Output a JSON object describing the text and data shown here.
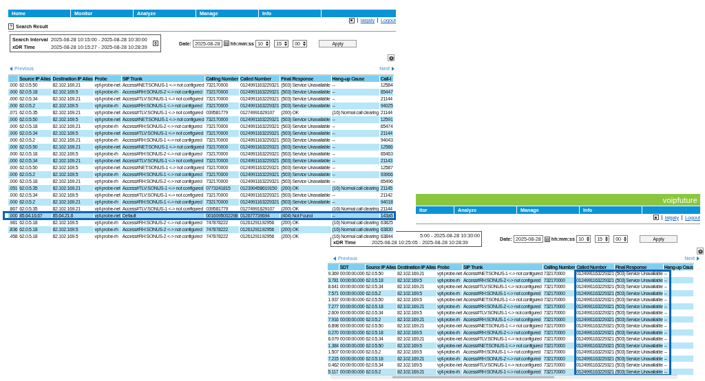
{
  "front_window": {
    "menu": [
      "Home",
      "Monitor",
      "Analyze",
      "Manage",
      "Info"
    ],
    "user_links": [
      "lalgaly",
      "Logout"
    ],
    "help_icon": "?",
    "title": "Search Result",
    "search_summary": [
      {
        "label": "Search Interval",
        "value": "2025-08-28 10:15:00 - 2025-08-28 10:30:00"
      },
      {
        "label": "xDR Time",
        "value": "2025-08-28 10:15:27 - 2025-08-28 10:28:39"
      }
    ],
    "date_label": "Date:",
    "date": "2025-08-28",
    "time_label": "hh:mm:ss",
    "time": [
      "10",
      "15",
      "00"
    ],
    "apply": "Apply",
    "previous": "Previous",
    "next": "Next",
    "table": {
      "columns": [
        "",
        "Source IP Alias",
        "Destination IP Alias",
        "Probe",
        "SIP Trunk",
        "Calling Number",
        "Called Number",
        "Final Response",
        "Hang-up Cause",
        "Call-I"
      ],
      "rows": [
        {
          "cells": [
            ".000",
            "62.0.5.50",
            "82.102.169.21",
            "vpf-probe-net",
            "Access#NET:SONUS-1 <-> not configured",
            "732170000",
            "0124991163229321",
            "(503) Service Unavailable",
            "--",
            "12584"
          ],
          "selected": false
        },
        {
          "cells": [
            ".000",
            "62.0.5.18",
            "82.102.169.5",
            "vpf-probe-rh",
            "Access#RH:SONUS-2 <-> not configured",
            "732170000",
            "0124991163229321",
            "(503) Service Unavailable",
            "--",
            "65447"
          ],
          "selected": false
        },
        {
          "cells": [
            ".000",
            "62.0.5.34",
            "82.102.169.21",
            "vpf-probe-net",
            "Access#TLV:SONUS-1 <-> not configured",
            "732170000",
            "0124991163229321",
            "(503) Service Unavailable",
            "--",
            "21144"
          ],
          "selected": false
        },
        {
          "cells": [
            ".000",
            "62.0.5.2",
            "82.102.169.5",
            "vpf-probe-rh",
            "Access#RH:SONUS-1 <-> not configured",
            "732170000",
            "0124991163229321",
            "(503) Service Unavailable",
            "--",
            "94025"
          ],
          "selected": false
        },
        {
          "cells": [
            ".071",
            "62.0.5.35",
            "82.102.169.21",
            "vpf-probe-net",
            "Access#TLV:SONUS-1 <-> not configured",
            "039581779",
            "01274991629107",
            "(200) OK",
            "(16) Normal call clearing",
            "21144"
          ],
          "selected": false
        },
        {
          "cells": [
            ".000",
            "62.0.5.50",
            "82.102.169.5",
            "vpf-probe-net",
            "Access#NET:SONUS-1 <-> not configured",
            "732170000",
            "0124991163229321",
            "(503) Service Unavailable",
            "--",
            "12591"
          ],
          "selected": false
        },
        {
          "cells": [
            ".000",
            "62.0.5.18",
            "82.102.169.21",
            "vpf-probe-rh",
            "Access#RH:SONUS-2 <-> not configured",
            "732170000",
            "0124991163229321",
            "(503) Service Unavailable",
            "--",
            "65474"
          ],
          "selected": false
        },
        {
          "cells": [
            ".000",
            "62.0.5.34",
            "82.102.169.5",
            "vpf-probe-net",
            "Access#TLV:SONUS-1 <-> not configured",
            "732170000",
            "0124991163229321",
            "(503) Service Unavailable",
            "--",
            "21144"
          ],
          "selected": false
        },
        {
          "cells": [
            ".000",
            "62.0.5.2",
            "82.102.169.21",
            "vpf-probe-rh",
            "Access#RH:SONUS-1 <-> not configured",
            "732170000",
            "0124991163229321",
            "(503) Service Unavailable",
            "--",
            "94043"
          ],
          "selected": false
        },
        {
          "cells": [
            ".000",
            "62.0.5.50",
            "82.102.169.21",
            "vpf-probe-net",
            "Access#NET:SONUS-1 <-> not configured",
            "732170000",
            "0124991163229321",
            "(503) Service Unavailable",
            "--",
            "12586"
          ],
          "selected": false
        },
        {
          "cells": [
            ".000",
            "62.0.5.18",
            "82.102.169.5",
            "vpf-probe-rh",
            "Access#RH:SONUS-2 <-> not configured",
            "732170000",
            "0124991163229321",
            "(503) Service Unavailable",
            "--",
            "65463"
          ],
          "selected": false
        },
        {
          "cells": [
            ".000",
            "62.0.5.34",
            "82.102.169.21",
            "vpf-probe-net",
            "Access#TLV:SONUS-1 <-> not configured",
            "732170000",
            "0124991163229321",
            "(503) Service Unavailable",
            "--",
            "21143"
          ],
          "selected": false
        },
        {
          "cells": [
            ".000",
            "62.0.5.50",
            "82.102.169.5",
            "vpf-probe-net",
            "Access#NET:SONUS-1 <-> not configured",
            "732170000",
            "0124991163229321",
            "(503) Service Unavailable",
            "--",
            "12587"
          ],
          "selected": false
        },
        {
          "cells": [
            ".000",
            "62.0.5.2",
            "82.102.169.5",
            "vpf-probe-rh",
            "Access#RH:SONUS-1 <-> not configured",
            "732170000",
            "0124991163229321",
            "(503) Service Unavailable",
            "--",
            "93966"
          ],
          "selected": false
        },
        {
          "cells": [
            ".000",
            "62.0.5.18",
            "82.102.169.21",
            "vpf-probe-rh",
            "Access#RH:SONUS-2 <-> not configured",
            "732170000",
            "0124991163229321",
            "(503) Service Unavailable",
            "--",
            "65496"
          ],
          "selected": false
        },
        {
          "cells": [
            ".051",
            "62.0.5.35",
            "82.102.169.21",
            "vpf-probe-net",
            "Access#TLV:SONUS-1 <-> not configured",
            "0773241815",
            "012390458619150",
            "(200) OK",
            "(16) Normal call clearing",
            "21145"
          ],
          "selected": false
        },
        {
          "cells": [
            ".000",
            "62.0.5.34",
            "82.102.169.5",
            "vpf-probe-net",
            "Access#TLV:SONUS-1 <-> not configured",
            "732170000",
            "0124991163229321",
            "(503) Service Unavailable",
            "--",
            "21142"
          ],
          "selected": false
        },
        {
          "cells": [
            ".000",
            "62.0.5.2",
            "82.102.169.21",
            "vpf-probe-rh",
            "Access#RH:SONUS-1 <-> not configured",
            "732170000",
            "0124991163229321",
            "(503) Service Unavailable",
            "--",
            "94018"
          ],
          "selected": false
        },
        {
          "cells": [
            ".867",
            "62.0.5.35",
            "82.102.169.21",
            "vpf-probe-net",
            "Access#TLV:SONUS-1 <-> not configured",
            "039581779",
            "01274991629107",
            "(200) OK",
            "(16) Normal call clearing",
            "21144"
          ],
          "selected": false
        },
        {
          "cells": [
            ".000",
            "85.64.16.67",
            "85.64.21.8",
            "vpf-probe-net",
            "Default",
            "0016095002298",
            "012677739694",
            "(404) Not Found",
            "--",
            "143a5"
          ],
          "selected": true
        },
        {
          "cells": [
            ".981",
            "62.0.5.18",
            "82.102.169.5",
            "vpf-probe-rh",
            "Access#RH:SONUS-2 <-> not configured",
            "747878222",
            "01261291192956",
            "(200) OK",
            "(16) Normal call clearing",
            "63825"
          ],
          "selected": false
        },
        {
          "cells": [
            ".836",
            "62.0.5.18",
            "82.102.169.5",
            "vpf-probe-rh",
            "Access#RH:SONUS-2 <-> not configured",
            "747878222",
            "01261291192956",
            "(200) OK",
            "(16) Normal call clearing",
            "63830"
          ],
          "selected": false
        },
        {
          "cells": [
            ".458",
            "62.0.5.18",
            "82.102.169.5",
            "vpf-probe-rh",
            "Access#RH:SONUS-2 <-> not configured",
            "747878222",
            "01261291192956",
            "(200) OK",
            "(16) Normal call clearing",
            "63844"
          ],
          "selected": false
        }
      ]
    }
  },
  "back_window": {
    "logo": "voipfuture",
    "menu": [
      "itor",
      "Analyze",
      "Manage",
      "Info"
    ],
    "user_links": [
      "lalgaly",
      "Logout"
    ],
    "search_summary": [
      {
        "value": "5:00 - 2025-08-28 10:30:00"
      },
      {
        "label": "xDR Time",
        "value": "2025-08-28 10:25:05 - 2025-08-28 10:28:39"
      }
    ],
    "date_label": "Date:",
    "date": "2025-08-28",
    "time_label": "hh:mm:ss",
    "time": [
      "10",
      "15",
      "00"
    ],
    "apply": "Apply",
    "previous": "Previous",
    "next": "Next",
    "table": {
      "columns": [
        {
          "framed": false
        },
        {
          "label": "SDT",
          "framed": false
        },
        {
          "label": "Source IP Alias",
          "framed": false
        },
        {
          "label": "Destination IP Alias",
          "framed": false
        },
        {
          "label": "Probe",
          "framed": false
        },
        {
          "label": "SIP Trunk",
          "framed": false
        },
        {
          "label": "Calling Number",
          "framed": false
        },
        {
          "label": "Called Number",
          "framed": true
        },
        {
          "label": "Final Response",
          "framed": true
        },
        {
          "label": "Hang-up Caus",
          "framed": false
        }
      ],
      "rows": [
        {
          "cells": [
            "9.369",
            "00:00:00.000",
            "62.0.5.50",
            "82.102.169.21",
            "vpf-probe-net",
            "Access#NET:SONUS-1 <-> not configured",
            "732170000",
            "0124991163229321",
            "(503) Service Unavailable",
            "--"
          ]
        },
        {
          "cells": [
            "3.781",
            "00:00:00.000",
            "62.0.5.18",
            "82.102.169.5",
            "vpf-probe-rh",
            "Access#RH:SONUS-2 <-> not configured",
            "732170000",
            "0124991163229321",
            "(503) Service Unavailable",
            "--"
          ]
        },
        {
          "cells": [
            "8.641",
            "00:00:00.000",
            "62.0.5.34",
            "82.102.169.21",
            "vpf-probe-net",
            "Access#TLV:SONUS-1 <-> not configured",
            "732170000",
            "0124991163229321",
            "(503) Service Unavailable",
            "--"
          ]
        },
        {
          "cells": [
            "7.571",
            "00:00:00.000",
            "62.0.5.2",
            "82.102.169.5",
            "vpf-probe-rh",
            "Access#RH:SONUS-1 <-> not configured",
            "732170000",
            "0124991163229321",
            "(503) Service Unavailable",
            "--"
          ]
        },
        {
          "cells": [
            "1.937",
            "00:00:00.000",
            "62.0.5.50",
            "82.102.169.5",
            "vpf-probe-net",
            "Access#NET:SONUS-1 <-> not configured",
            "732170000",
            "0124991163229321",
            "(503) Service Unavailable",
            "--"
          ]
        },
        {
          "cells": [
            "7.277",
            "00:00:00.000",
            "62.0.5.18",
            "82.102.169.21",
            "vpf-probe-rh",
            "Access#RH:SONUS-2 <-> not configured",
            "732170000",
            "0124991163229321",
            "(503) Service Unavailable",
            "--"
          ]
        },
        {
          "cells": [
            "2.609",
            "00:00:00.000",
            "62.0.5.34",
            "82.102.169.5",
            "vpf-probe-net",
            "Access#TLV:SONUS-1 <-> not configured",
            "732170000",
            "0124991163229321",
            "(503) Service Unavailable",
            "--"
          ]
        },
        {
          "cells": [
            "7.916",
            "00:00:00.000",
            "62.0.5.2",
            "82.102.169.21",
            "vpf-probe-rh",
            "Access#RH:SONUS-1 <-> not configured",
            "732170000",
            "0124991163229321",
            "(503) Service Unavailable",
            "--"
          ]
        },
        {
          "cells": [
            "6.898",
            "00:00:00.000",
            "62.0.5.50",
            "82.102.169.21",
            "vpf-probe-net",
            "Access#NET:SONUS-1 <-> not configured",
            "732170000",
            "0124991163229321",
            "(503) Service Unavailable",
            "--"
          ]
        },
        {
          "cells": [
            "0.270",
            "00:00:00.000",
            "62.0.5.18",
            "82.102.169.5",
            "vpf-probe-rh",
            "Access#RH:SONUS-2 <-> not configured",
            "732170000",
            "0124991163229321",
            "(503) Service Unavailable",
            "--"
          ]
        },
        {
          "cells": [
            "6.079",
            "00:00:00.000",
            "62.0.5.34",
            "82.102.169.21",
            "vpf-probe-net",
            "Access#TLV:SONUS-1 <-> not configured",
            "732170000",
            "0124991163229321",
            "(503) Service Unavailable",
            "--"
          ]
        },
        {
          "cells": [
            "1.384",
            "00:00:00.000",
            "62.0.5.50",
            "82.102.169.5",
            "vpf-probe-net",
            "Access#NET:SONUS-1 <-> not configured",
            "732170000",
            "0124991163229321",
            "(503) Service Unavailable",
            "--"
          ]
        },
        {
          "cells": [
            "1.507",
            "00:00:00.000",
            "62.0.5.2",
            "82.102.169.5",
            "vpf-probe-rh",
            "Access#RH:SONUS-1 <-> not configured",
            "732170000",
            "0124991163229321",
            "(503) Service Unavailable",
            "--"
          ]
        },
        {
          "cells": [
            "7.215",
            "00:00:00.000",
            "62.0.5.18",
            "82.102.169.21",
            "vpf-probe-rh",
            "Access#RH:SONUS-2 <-> not configured",
            "732170000",
            "0124991163229321",
            "(503) Service Unavailable",
            "--"
          ]
        },
        {
          "cells": [
            "0.462",
            "00:00:00.000",
            "62.0.5.34",
            "82.102.169.5",
            "vpf-probe-net",
            "Access#TLV:SONUS-1 <-> not configured",
            "732170000",
            "0124991163229321",
            "(503) Service Unavailable",
            "--"
          ]
        },
        {
          "cells": [
            "5.117",
            "00:00:00.000",
            "62.0.5.2",
            "82.102.169.21",
            "vpf-probe-rh",
            "Access#RH:SONUS-1 <-> not configured",
            "732170000",
            "0124991163229321",
            "(503) Service Unavailable",
            "--"
          ]
        }
      ]
    }
  }
}
